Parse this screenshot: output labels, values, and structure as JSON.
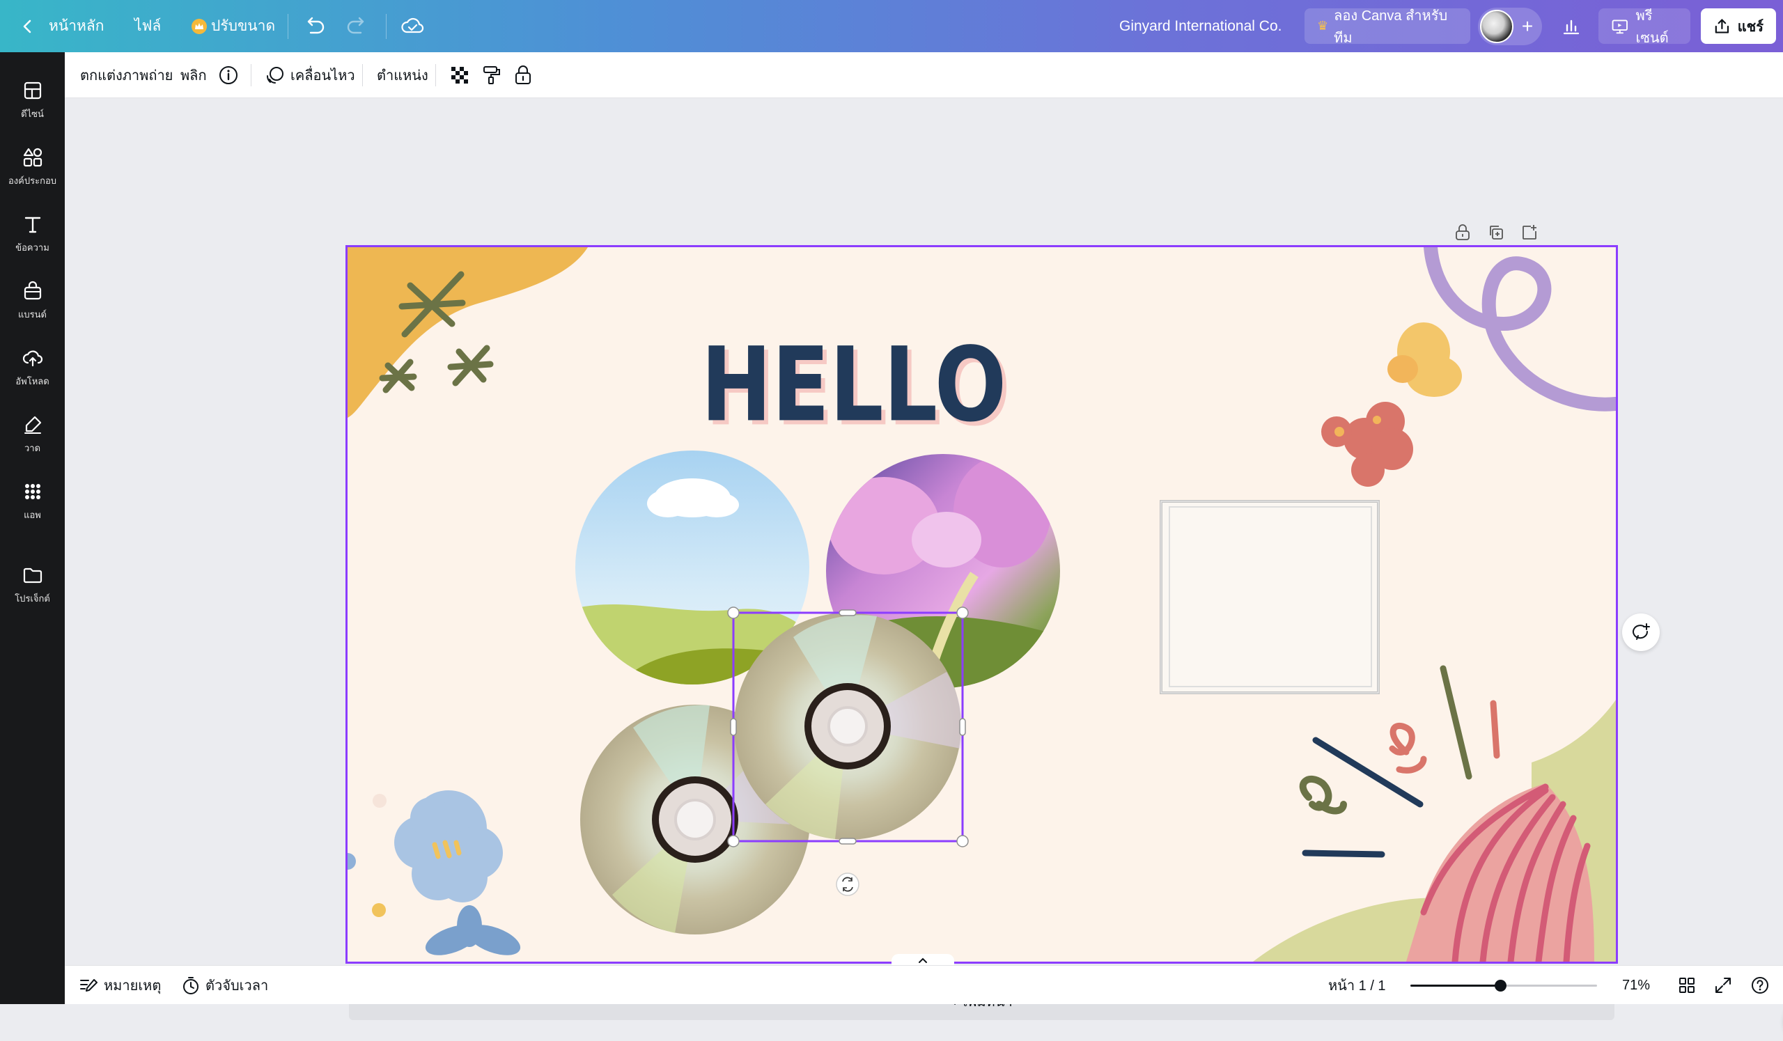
{
  "topbar": {
    "home_label": "หน้าหลัก",
    "file_label": "ไฟล์",
    "resize_label": "ปรับขนาด",
    "team_name": "Ginyard International Co.",
    "try_canva_label": "ลอง Canva สำหรับทีม",
    "present_label": "พรีเซนต์",
    "share_label": "แชร์"
  },
  "rail": {
    "items": [
      {
        "label": "ดีไซน์",
        "icon": "layout-icon"
      },
      {
        "label": "องค์ประกอบ",
        "icon": "shapes-icon"
      },
      {
        "label": "ข้อความ",
        "icon": "text-icon"
      },
      {
        "label": "แบรนด์",
        "icon": "brand-icon"
      },
      {
        "label": "อัพโหลด",
        "icon": "upload-icon"
      },
      {
        "label": "วาด",
        "icon": "draw-icon"
      },
      {
        "label": "แอพ",
        "icon": "apps-icon"
      },
      {
        "label": "โปรเจ็กต์",
        "icon": "folder-icon"
      }
    ]
  },
  "context_toolbar": {
    "edit_photo_label": "ตกแต่งภาพถ่าย",
    "flip_label": "พลิก",
    "animate_label": "เคลื่อนไหว",
    "position_label": "ตำแหน่ง"
  },
  "canvas": {
    "heading_text": "HELLO",
    "add_page_label": "+ เพิ่มหน้า"
  },
  "footer": {
    "notes_label": "หมายเหตุ",
    "timer_label": "ตัวจับเวลา",
    "page_indicator": "หน้า 1 / 1",
    "zoom_level": "71%",
    "zoom_fraction": 0.48
  },
  "colors": {
    "accent": "#8b3dff",
    "page_bg": "#fdf3ea",
    "heading": "#213a5a"
  }
}
